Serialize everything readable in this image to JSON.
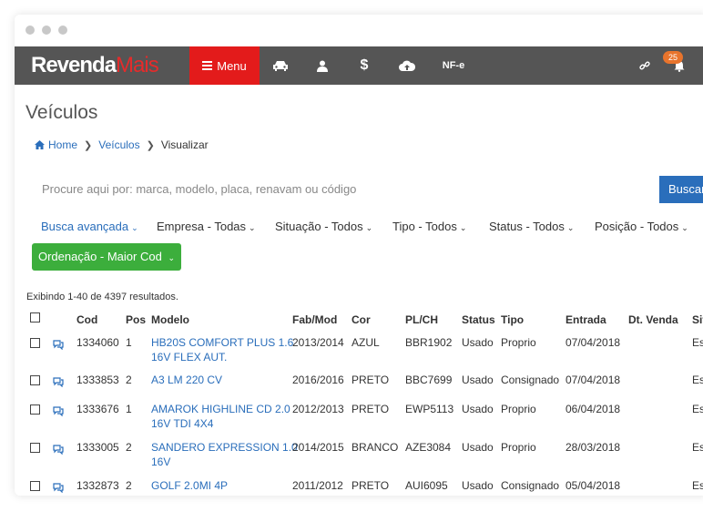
{
  "app": {
    "brand_part1": "Revenda",
    "brand_part2": "Mais",
    "menu_label": "Menu",
    "nfe_label": "NF-e",
    "notification_count": "25"
  },
  "nav_icons": [
    "car-icon",
    "user-icon",
    "dollar-icon",
    "cloud-upload-icon",
    "link-icon",
    "bell-icon"
  ],
  "page": {
    "title": "Veículos",
    "breadcrumb": {
      "home": "Home",
      "section": "Veículos",
      "current": "Visualizar"
    }
  },
  "search": {
    "placeholder": "Procure aqui por: marca, modelo, placa, renavam ou código",
    "button": "Buscar"
  },
  "filters": {
    "advanced": "Busca avançada",
    "empresa": "Empresa - Todas",
    "situacao": "Situação - Todos",
    "tipo": "Tipo - Todos",
    "status": "Status - Todos",
    "posicao": "Posição - Todos",
    "ordenacao": "Ordenação - Maior Cod"
  },
  "results_text": "Exibindo 1-40 de 4397 resultados.",
  "table": {
    "headers": {
      "cod": "Cod",
      "pos": "Pos",
      "modelo": "Modelo",
      "fabmod": "Fab/Mod",
      "cor": "Cor",
      "plch": "PL/CH",
      "status": "Status",
      "tipo": "Tipo",
      "entrada": "Entrada",
      "dtvenda": "Dt. Venda",
      "situacao": "Sit"
    },
    "rows": [
      {
        "cod": "1334060",
        "pos": "1",
        "modelo_l1": "HB20S COMFORT PLUS 1.6",
        "modelo_l2": "16V FLEX AUT.",
        "fabmod": "2013/2014",
        "cor": "AZUL",
        "plch": "BBR1902",
        "status": "Usado",
        "tipo": "Proprio",
        "entrada": "07/04/2018",
        "dtvenda": "",
        "situacao": "Es"
      },
      {
        "cod": "1333853",
        "pos": "2",
        "modelo_l1": "A3 LM 220 CV",
        "modelo_l2": "",
        "fabmod": "2016/2016",
        "cor": "PRETO",
        "plch": "BBC7699",
        "status": "Usado",
        "tipo": "Consignado",
        "entrada": "07/04/2018",
        "dtvenda": "",
        "situacao": "Es"
      },
      {
        "cod": "1333676",
        "pos": "1",
        "modelo_l1": "AMAROK HIGHLINE CD 2.0",
        "modelo_l2": "16V TDI 4X4",
        "fabmod": "2012/2013",
        "cor": "PRETO",
        "plch": "EWP5113",
        "status": "Usado",
        "tipo": "Proprio",
        "entrada": "06/04/2018",
        "dtvenda": "",
        "situacao": "Es"
      },
      {
        "cod": "1333005",
        "pos": "2",
        "modelo_l1": "SANDERO EXPRESSION 1.0",
        "modelo_l2": "16V",
        "fabmod": "2014/2015",
        "cor": "BRANCO",
        "plch": "AZE3084",
        "status": "Usado",
        "tipo": "Proprio",
        "entrada": "28/03/2018",
        "dtvenda": "",
        "situacao": "Es"
      },
      {
        "cod": "1332873",
        "pos": "2",
        "modelo_l1": "GOLF 2.0MI 4P",
        "modelo_l2": "",
        "fabmod": "2011/2012",
        "cor": "PRETO",
        "plch": "AUI6095",
        "status": "Usado",
        "tipo": "Consignado",
        "entrada": "05/04/2018",
        "dtvenda": "",
        "situacao": "Es"
      }
    ]
  },
  "colors": {
    "navbar": "#555555",
    "accent_red": "#e31b1b",
    "link_blue": "#2a6ebb",
    "green": "#3cae3c",
    "badge_orange": "#e8742c"
  }
}
